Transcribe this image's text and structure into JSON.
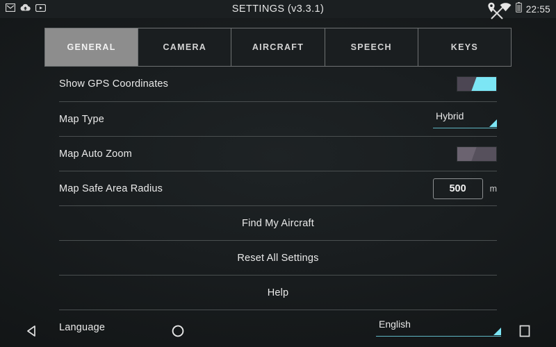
{
  "statusbar": {
    "title": "SETTINGS (v3.3.1)",
    "time": "22:55",
    "left_icons": [
      "gmail-icon",
      "drive-upload-icon",
      "youtube-icon"
    ],
    "right_icons": [
      "location-pin-icon",
      "wifi-icon",
      "battery-icon"
    ],
    "close_label": "close-icon"
  },
  "tabs": [
    {
      "label": "GENERAL",
      "selected": true
    },
    {
      "label": "CAMERA",
      "selected": false
    },
    {
      "label": "AIRCRAFT",
      "selected": false
    },
    {
      "label": "SPEECH",
      "selected": false
    },
    {
      "label": "KEYS",
      "selected": false
    }
  ],
  "settings": {
    "show_gps": {
      "label": "Show GPS Coordinates",
      "state": "on"
    },
    "map_type": {
      "label": "Map Type",
      "value": "Hybrid"
    },
    "map_auto_zoom": {
      "label": "Map Auto Zoom",
      "state": "off"
    },
    "map_safe_area": {
      "label": "Map Safe Area Radius",
      "value": "500",
      "unit": "m"
    },
    "find_aircraft": {
      "label": "Find My Aircraft"
    },
    "reset_all": {
      "label": "Reset All Settings"
    },
    "help": {
      "label": "Help"
    },
    "language": {
      "label": "Language",
      "value": "English"
    }
  },
  "navbar": {
    "back": "back-triangle-icon",
    "home": "home-circle-icon",
    "recents": "recents-square-icon"
  },
  "colors": {
    "background": "#191d1f",
    "accent_cyan": "#7ce6f5",
    "divider": "#4a4f50",
    "tab_selected": "#8d8d8d",
    "toggle_off": "#6b6370"
  }
}
